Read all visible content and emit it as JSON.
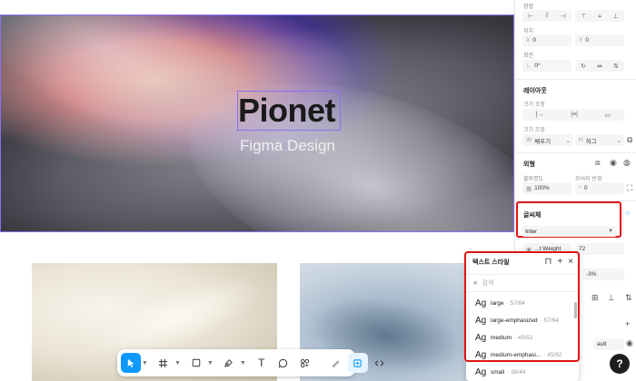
{
  "canvas": {
    "hero_title": "Pionet",
    "hero_subtitle": "Figma Design"
  },
  "toolbar": {
    "tools": [
      "move-tool",
      "frame-tool",
      "shape-tool",
      "pen-tool",
      "text-tool",
      "comment-tool",
      "components-tool",
      "draw-mode",
      "design-mode",
      "dev-mode"
    ],
    "text_tool_glyph": "T"
  },
  "panel": {
    "position_label": "정렬",
    "position_xy_label": "위치",
    "x_prefix": "X",
    "x_value": "0",
    "y_prefix": "Y",
    "y_value": "0",
    "rotation_label": "회전",
    "rotation_value": "0°",
    "layout_title": "레이아웃",
    "size_label": "크기 조정",
    "size2_label": "크기 조정",
    "width_prefix": "W",
    "width_value": "채우기",
    "height_prefix": "H",
    "height_value": "허그",
    "appearance_title": "외형",
    "opacity_label": "불투명도",
    "opacity_value": "100%",
    "radius_label": "모서리 반경",
    "radius_value": "0",
    "typography_title": "글씨체",
    "font_family": "Inter",
    "font_weight": "...t Weight",
    "font_size": "72",
    "letter_spacing": "-3%",
    "fill_partial": "ault",
    "help_label": "?"
  },
  "text_styles_popup": {
    "title": "텍스트 스타일",
    "search_placeholder": "검색",
    "items": [
      {
        "name": "large",
        "meta": "57/64"
      },
      {
        "name": "large-emphasized",
        "meta": "57/64"
      },
      {
        "name": "medium",
        "meta": "45/52"
      },
      {
        "name": "medium-emphasi...",
        "meta": "45/52"
      },
      {
        "name": "small",
        "meta": "36/44"
      }
    ],
    "glyph": "Ag"
  },
  "colors": {
    "accent": "#0d99ff",
    "selection": "#8b6ff0",
    "highlight": "#e01414"
  }
}
